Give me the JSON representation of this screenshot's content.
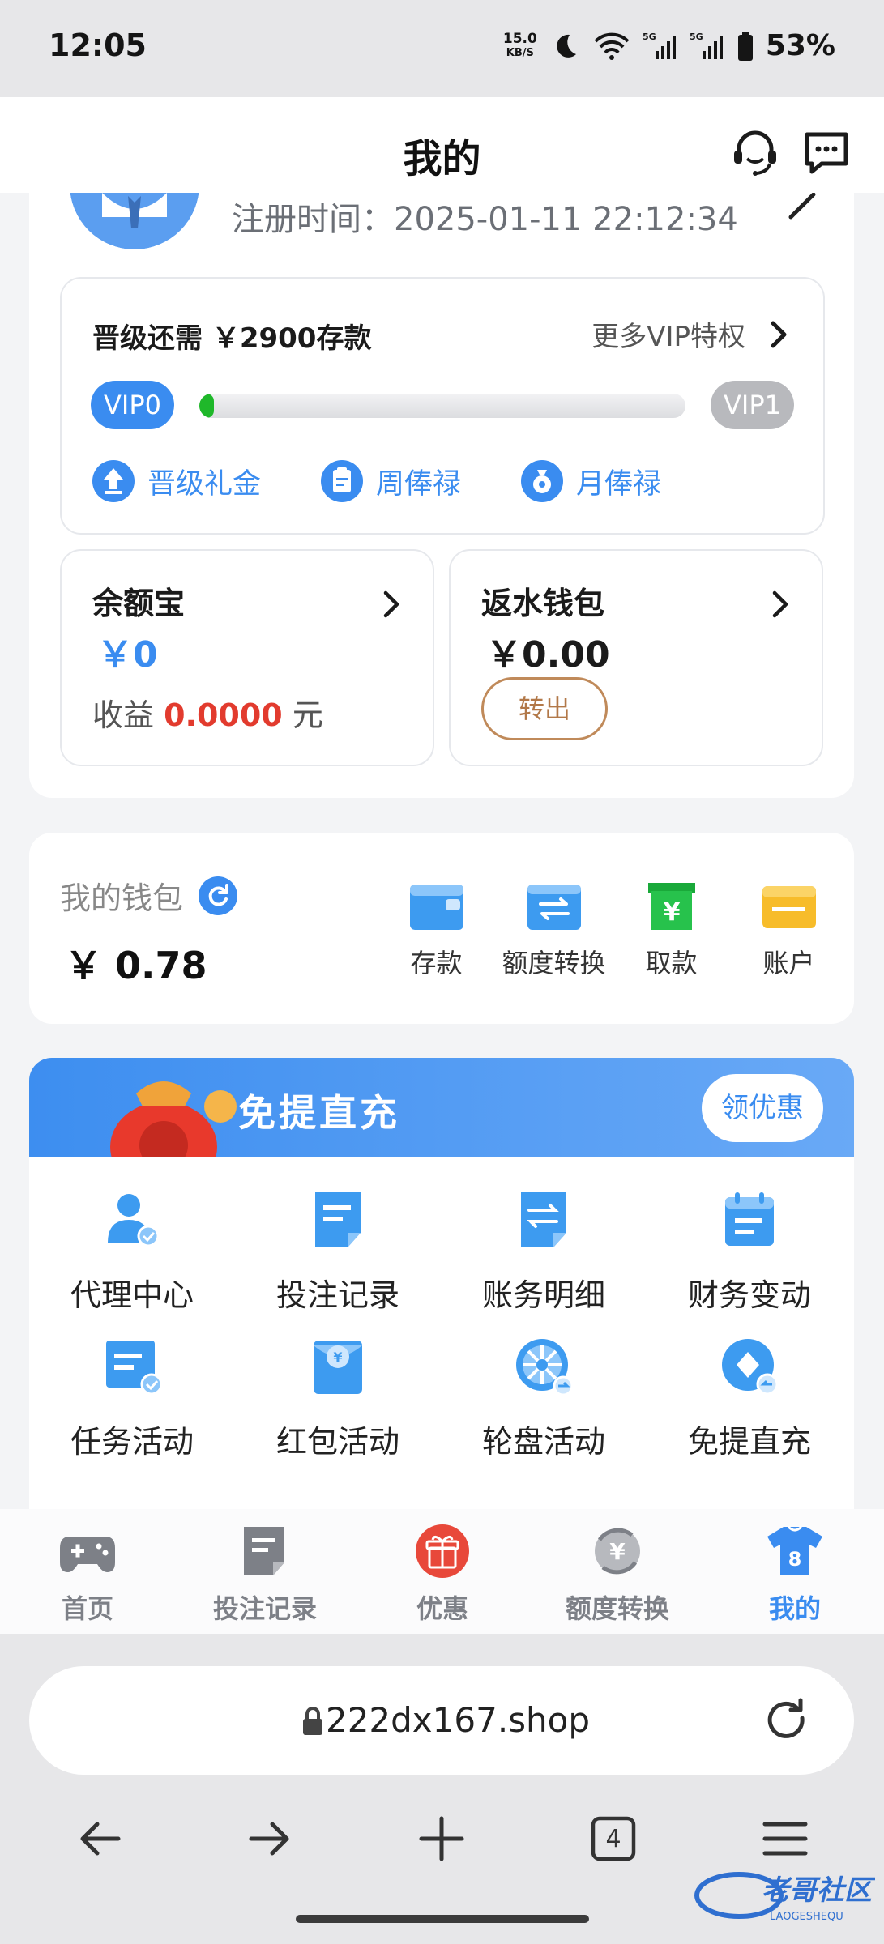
{
  "status_bar": {
    "time": "12:05",
    "net_speed_value": "15.0",
    "net_speed_unit": "KB/S",
    "battery": "53%",
    "icons": [
      "moon-icon",
      "wifi-icon",
      "signal-5g-icon",
      "signal-5g-icon",
      "battery-icon"
    ]
  },
  "header": {
    "title": "我的",
    "icons": [
      "customer-service-icon",
      "message-icon"
    ]
  },
  "profile": {
    "register_time": "注册时间：2025-01-11 22:12:34"
  },
  "vip": {
    "need_text": "晋级还需 ￥2900存款",
    "more_label": "更多VIP特权",
    "current_level": "VIP0",
    "next_level": "VIP1",
    "progress_fraction": 0.03,
    "perks": [
      {
        "label": "晋级礼金",
        "icon": "upgrade-arrow-icon"
      },
      {
        "label": "周俸禄",
        "icon": "clipboard-icon"
      },
      {
        "label": "月俸禄",
        "icon": "money-bag-icon"
      }
    ]
  },
  "yuebao": {
    "title": "余额宝",
    "amount": "￥0",
    "income_prefix": "收益",
    "income_value": "0.0000",
    "income_suffix": "元"
  },
  "rebate_wallet": {
    "title": "返水钱包",
    "amount": "￥0.00",
    "transfer_label": "转出"
  },
  "my_wallet": {
    "label": "我的钱包",
    "balance": "￥ 0.78",
    "actions": [
      {
        "label": "存款",
        "icon": "deposit-card-icon"
      },
      {
        "label": "额度转换",
        "icon": "transfer-card-icon"
      },
      {
        "label": "取款",
        "icon": "withdraw-icon"
      },
      {
        "label": "账户",
        "icon": "account-card-icon"
      }
    ]
  },
  "banner": {
    "title": "免提直充",
    "button": "领优惠"
  },
  "grid": [
    {
      "label": "代理中心",
      "icon": "agent-icon"
    },
    {
      "label": "投注记录",
      "icon": "bet-record-icon"
    },
    {
      "label": "账务明细",
      "icon": "account-detail-icon"
    },
    {
      "label": "财务变动",
      "icon": "finance-change-icon"
    },
    {
      "label": "任务活动",
      "icon": "task-icon"
    },
    {
      "label": "红包活动",
      "icon": "red-packet-icon"
    },
    {
      "label": "轮盘活动",
      "icon": "roulette-icon"
    },
    {
      "label": "免提直充",
      "icon": "direct-recharge-icon"
    }
  ],
  "bottom_nav": [
    {
      "label": "首页",
      "icon": "gamepad-icon"
    },
    {
      "label": "投注记录",
      "icon": "bet-record-icon"
    },
    {
      "label": "优惠",
      "icon": "gift-icon"
    },
    {
      "label": "额度转换",
      "icon": "yuan-exchange-icon"
    },
    {
      "label": "我的",
      "icon": "jersey-icon",
      "jersey_number": "8"
    }
  ],
  "browser": {
    "url": "222dx167.shop",
    "tab_count": "4",
    "watermark": "老哥社区",
    "watermark_sub": "LAOGESHEQU"
  },
  "colors": {
    "accent": "#3a8cf0",
    "income_red": "#e23b2e",
    "transfer_border": "#c08a5a"
  }
}
